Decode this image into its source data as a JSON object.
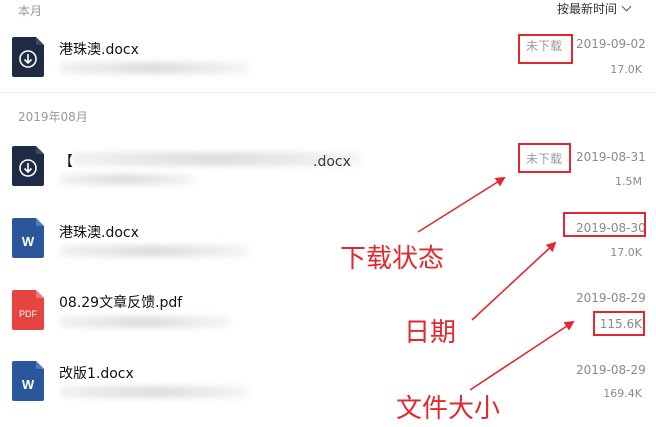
{
  "header": {
    "section_current": "本月",
    "sort_label": "按最新时间"
  },
  "section_aug": "2019年08月",
  "files": [
    {
      "name": "港珠澳.docx",
      "status": "未下载",
      "date": "2019-09-02",
      "size": "17.0K",
      "icon": "download-file-icon"
    },
    {
      "name_prefix": "【",
      "name_suffix": ".docx",
      "status": "未下载",
      "date": "2019-08-31",
      "size": "1.5M",
      "icon": "download-file-icon"
    },
    {
      "name": "港珠澳.docx",
      "date": "2019-08-30",
      "size": "17.0K",
      "icon": "word-file-icon",
      "icon_text": "W"
    },
    {
      "name": "08.29文章反馈.pdf",
      "date": "2019-08-29",
      "size": "115.6K",
      "icon": "pdf-file-icon",
      "icon_text": "PDF"
    },
    {
      "name": "改版1.docx",
      "date": "2019-08-29",
      "size": "169.4K",
      "icon": "word-file-icon",
      "icon_text": "W"
    }
  ],
  "annotations": {
    "status": "下载状态",
    "date": "日期",
    "size": "文件大小"
  },
  "colors": {
    "annotation_red": "#e0282e",
    "word_blue": "#2b579a",
    "pdf_red": "#e5443f",
    "download_navy": "#1f2b44"
  }
}
